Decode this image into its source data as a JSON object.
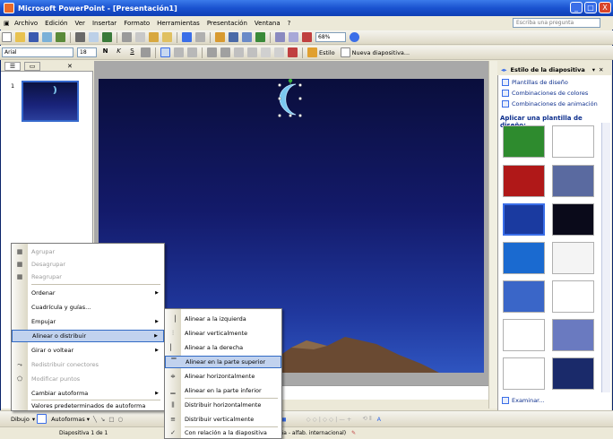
{
  "window": {
    "title": "Microsoft PowerPoint - [Presentación1]",
    "minimize": "_",
    "maximize": "□",
    "close": "X"
  },
  "menubar": {
    "items": [
      "Archivo",
      "Edición",
      "Ver",
      "Insertar",
      "Formato",
      "Herramientas",
      "Presentación",
      "Ventana",
      "?"
    ],
    "help_placeholder": "Escriba una pregunta"
  },
  "toolbar": {
    "zoom": "68%"
  },
  "formatting": {
    "font": "Arial",
    "size": "18",
    "bold": "N",
    "italic": "K",
    "underline": "S",
    "design_label": "Estilo",
    "new_slide_label": "Nueva diapositiva..."
  },
  "outline": {
    "slide_number": "1"
  },
  "taskpane": {
    "title": "Estilo de la diapositiva",
    "links": [
      "Plantillas de diseño",
      "Combinaciones de colores",
      "Combinaciones de animación"
    ],
    "apply_label": "Aplicar una plantilla de diseño:",
    "browse_label": "Examinar...",
    "colors": {
      "templates": [
        "#2e8b2e",
        "#ffffff",
        "#b01818",
        "#5a6aa0",
        "#1a3aa0",
        "#0a0a1a",
        "#1a6ad0",
        "#f4f4f4",
        "#3a66c8",
        "#ffffff",
        "#ffffff",
        "#6a7ac0",
        "#ffffff",
        "#1a2a6a",
        "#e8e8e8",
        "#1a2a6a"
      ]
    }
  },
  "context_menu": {
    "items": [
      {
        "label": "Agrupar",
        "disabled": true
      },
      {
        "label": "Desagrupar",
        "disabled": true
      },
      {
        "label": "Reagrupar",
        "disabled": true
      },
      {
        "label": "Ordenar",
        "disabled": false,
        "submenu": true
      },
      {
        "label": "Cuadrícula y guías...",
        "disabled": false
      },
      {
        "label": "Empujar",
        "disabled": false,
        "submenu": true
      },
      {
        "label": "Alinear o distribuir",
        "disabled": false,
        "submenu": true,
        "highlighted": true
      },
      {
        "label": "Girar o voltear",
        "disabled": false,
        "submenu": true
      },
      {
        "label": "Redistribuir conectores",
        "disabled": true
      },
      {
        "label": "Modificar puntos",
        "disabled": true
      },
      {
        "label": "Cambiar autoforma",
        "disabled": false,
        "submenu": true
      },
      {
        "label": "Valores predeterminados de autoforma",
        "disabled": false
      }
    ]
  },
  "submenu": {
    "items": [
      {
        "label": "Alinear a la izquierda",
        "icon": "▕"
      },
      {
        "label": "Alinear verticalmente",
        "icon": "⫶"
      },
      {
        "label": "Alinear a la derecha",
        "icon": "▏"
      },
      {
        "label": "Alinear en la parte superior",
        "icon": "▔",
        "highlighted": true
      },
      {
        "label": "Alinear horizontalmente",
        "icon": "≑"
      },
      {
        "label": "Alinear en la parte inferior",
        "icon": "▁"
      },
      {
        "label": "Distribuir horizontalmente",
        "icon": "⫼"
      },
      {
        "label": "Distribuir verticalmente",
        "icon": "≡"
      },
      {
        "label": "Con relación a la diapositiva",
        "icon": "✓"
      }
    ]
  },
  "drawbar": {
    "draw_label": "Dibujo",
    "autoshapes_label": "Autoformas"
  },
  "statusbar": {
    "slide": "Diapositiva 1 de 1",
    "language": "español (España - alfab. internacional)"
  }
}
